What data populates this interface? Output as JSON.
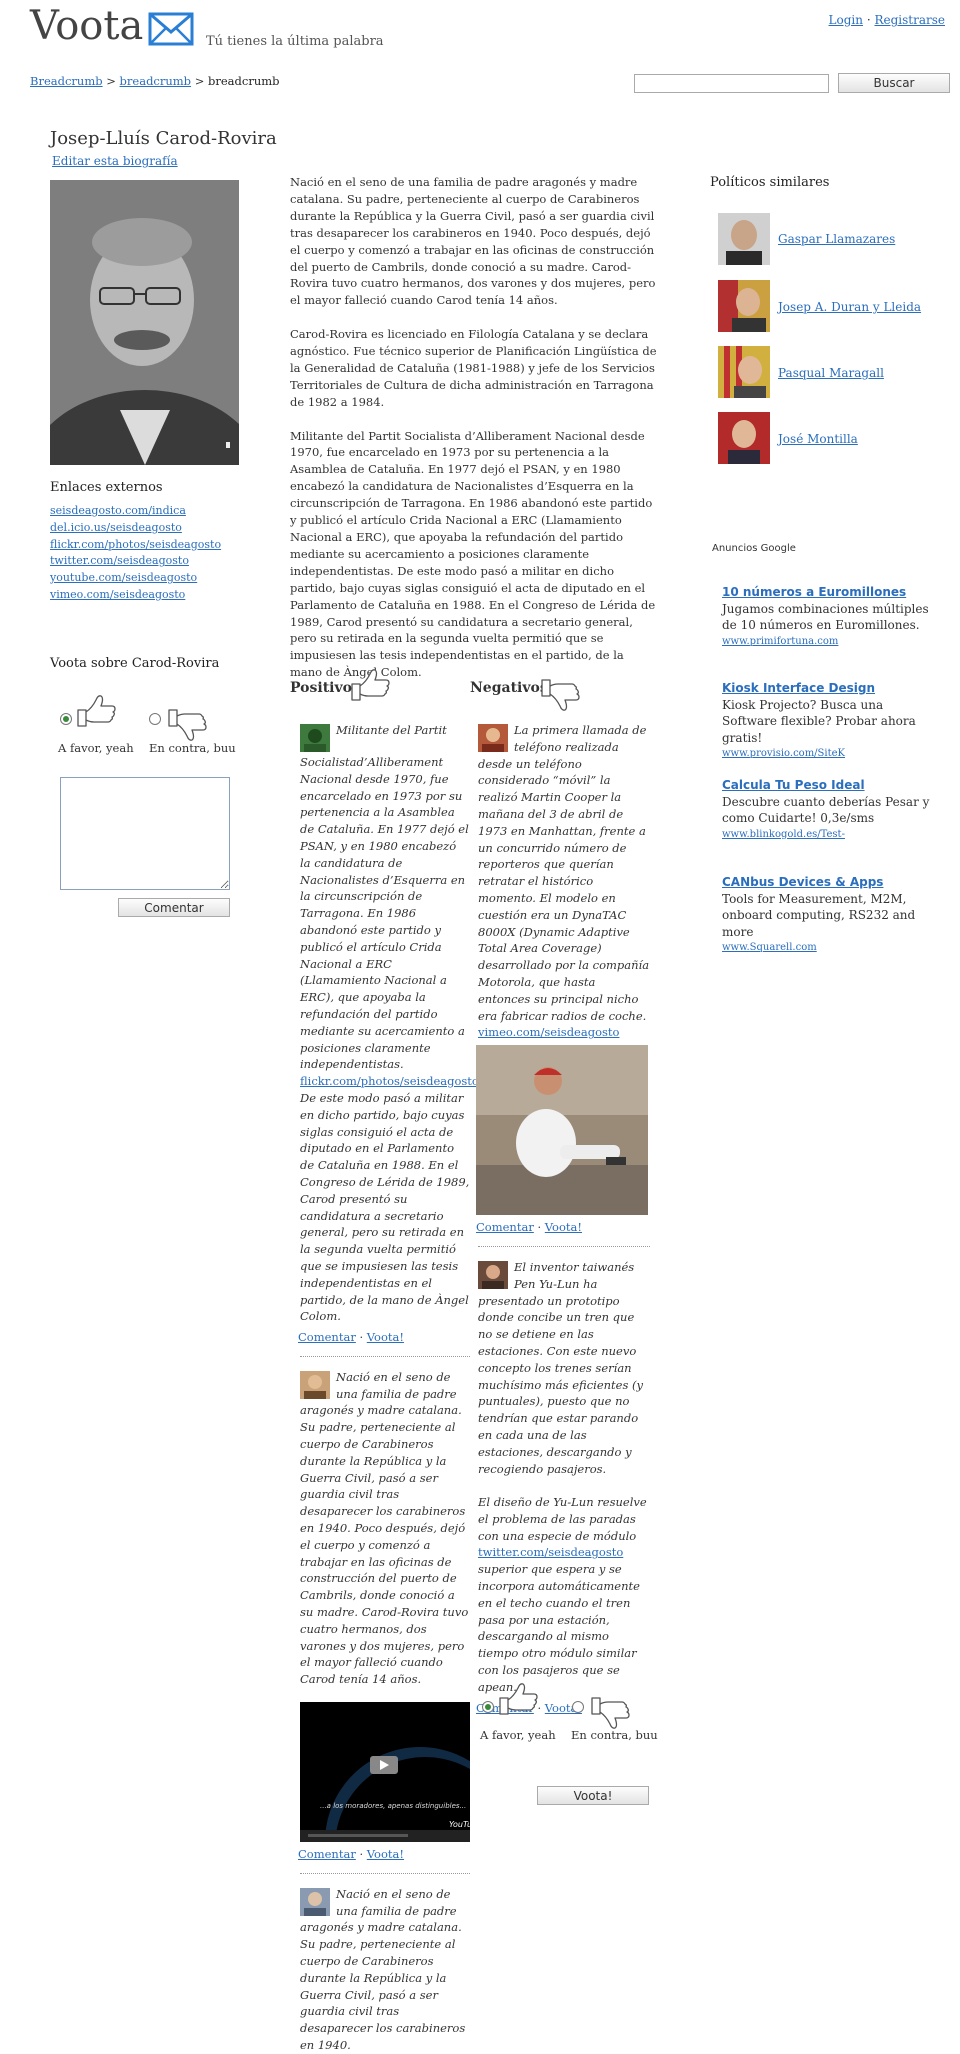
{
  "header": {
    "logo": "Voota",
    "tagline": "Tú tienes la última palabra",
    "login": "Login",
    "auth_separator": "·",
    "register": "Registrarse",
    "breadcrumb": [
      {
        "label": "Breadcrumb",
        "link": true
      },
      {
        "label": "breadcrumb",
        "link": true
      },
      {
        "label": "breadcrumb",
        "link": false
      }
    ],
    "breadcrumb_separator": ">",
    "search_button": "Buscar",
    "search_value": ""
  },
  "profile": {
    "name": "Josep-Lluís Carod-Rovira",
    "edit_bio": "Editar esta biografía",
    "external_links_title": "Enlaces externos",
    "external_links": [
      "seisdeagosto.com/indica",
      "del.icio.us/seisdeagosto",
      "flickr.com/photos/seisdeagosto",
      "twitter.com/seisdeagosto",
      "youtube.com/seisdeagosto",
      "vimeo.com/seisdeagosto"
    ]
  },
  "vote_box": {
    "title": "Voota sobre Carod-Rovira",
    "favor_label": "A favor, yeah",
    "contra_label": "En contra, buu",
    "favor_selected": true,
    "comment_value": "",
    "comment_button": "Comentar"
  },
  "bio": [
    "Nació en el seno de una familia de padre aragonés y madre catalana. Su padre, perteneciente al cuerpo de Carabineros durante la República y la Guerra Civil, pasó a ser guardia civil tras desaparecer los carabineros en 1940. Poco después, dejó el cuerpo y comenzó a trabajar en las oficinas de construcción del puerto de Cambrils, donde conoció a su madre. Carod-Rovira tuvo cuatro hermanos, dos varones y dos mujeres, pero el mayor falleció cuando Carod tenía 14 años.",
    "Carod-Rovira es licenciado en Filología Catalana y se declara agnóstico. Fue técnico superior de Planificación Lingüística de la Generalidad de Cataluña (1981-1988) y jefe de los Servicios Territoriales de Cultura de dicha administración en Tarragona de 1982 a 1984.",
    "Militante del Partit Socialista d’Alliberament Nacional desde 1970, fue encarcelado en 1973 por su pertenencia a la Asamblea de Cataluña. En 1977 dejó el PSAN, y en 1980 encabezó la candidatura de Nacionalistes d’Esquerra en la circunscripción de Tarragona. En 1986 abandonó este partido y publicó el artículo Crida Nacional a ERC (Llamamiento Nacional a ERC), que apoyaba la refundación del partido mediante su acercamiento a posiciones claramente independentistas. De este modo pasó a militar en dicho partido, bajo cuyas siglas consiguió el acta de diputado en el Parlamento de Cataluña en 1988. En el Congreso de Lérida de 1989, Carod presentó su candidatura a secretario general, pero su retirada en la segunda vuelta permitió que se impusiesen las tesis independentistas en el partido, de la mano de Àngel Colom."
  ],
  "positives": {
    "title": "Positivos",
    "comment_label": "Comentar",
    "voota_label": "Voota!",
    "meta_separator": "·",
    "items": [
      {
        "text1": "Militante del Partit Socialistad’Alliberament Nacional desde 1970, fue encarcelado en 1973 por su pertenencia a la Asamblea de Cataluña. En 1977 dejó el PSAN, y en 1980 encabezó la candidatura de Nacionalistes d’Esquerra en la circunscripción de Tarragona. En 1986 abandonó este partido y publicó el artículo Crida Nacional a ERC (Llamamiento Nacional a ERC), que apoyaba la refundación del partido mediante su acercamiento a posiciones claramente independentistas.",
        "link": "flickr.com/photos/seisdeagosto",
        "text2": "De este modo pasó a militar en dicho partido, bajo cuyas siglas consiguió el acta de diputado en el Parlamento de Cataluña en 1988. En el Congreso de Lérida de 1989, Carod presentó su candidatura a secretario general, pero su retirada en la segunda vuelta permitió que se impusiesen las tesis independentistas en el partido, de la mano de Àngel Colom."
      },
      {
        "text1": "Nació en el seno de una familia de padre aragonés y madre catalana. Su padre, perteneciente al cuerpo de Carabineros durante la República y la Guerra Civil, pasó a ser guardia civil tras desaparecer los carabineros en 1940. Poco después, dejó el cuerpo y comenzó a trabajar en las oficinas de construcción del puerto de Cambrils, donde conoció a su madre. Carod-Rovira tuvo cuatro hermanos, dos varones y dos mujeres, pero el mayor falleció cuando Carod tenía 14 años.",
        "video_caption": "...a los moradores, apenas distinguibles..."
      },
      {
        "text1": "Nació en el seno de una familia de padre aragonés y madre catalana. Su padre, perteneciente al cuerpo de Carabineros durante la República y la Guerra Civil, pasó a ser guardia civil tras desaparecer los carabineros en 1940."
      }
    ]
  },
  "negatives": {
    "title": "Negativos",
    "items": [
      {
        "text1": "La primera llamada de teléfono realizada desde un teléfono considerado “móvil” la realizó Martin Cooper la mañana del 3 de abril de 1973 en Manhattan, frente a un concurrido número de reporteros que querían retratar el histórico momento. El modelo en cuestión era un DynaTAC 8000X (Dynamic Adaptive Total Area Coverage) desarrollado por la compañía Motorola, que hasta entonces su principal nicho era fabricar radios de coche.",
        "link": "vimeo.com/seisdeagosto"
      },
      {
        "text1": "El inventor taiwanés Pen Yu-Lun ha presentado un prototipo donde concibe un tren que no se detiene en las estaciones. Con este nuevo concepto los trenes serían muchísimo más eficientes (y puntuales), puesto que no tendrían que estar parando en cada una de las estaciones, descargando y recogiendo pasajeros.",
        "text2": "El diseño de Yu-Lun resuelve el problema de las paradas con una especie de módulo",
        "link": "twitter.com/seisdeagosto",
        "text3": "superior que espera y se incorpora automáticamente en el techo cuando el tren pasa por una estación, descargando al mismo tiempo otro módulo similar con los pasajeros que se apean."
      }
    ],
    "vote_favor": "A favor, yeah",
    "vote_contra": "En contra, buu",
    "vote_button": "Voota!"
  },
  "similar": {
    "title": "Políticos similares",
    "items": [
      "Gaspar Llamazares",
      "Josep A. Duran y Lleida",
      "Pasqual Maragall",
      "José Montilla"
    ]
  },
  "ads": {
    "label": "Anuncios Google",
    "items": [
      {
        "title": "10 números a Euromillones",
        "text": "Jugamos combinaciones múltiples de 10 números en Euromillones.",
        "url": "www.primifortuna.com"
      },
      {
        "title": "Kiosk Interface Design",
        "text": "Kiosk Projecto? Busca una Software flexible? Probar ahora gratis!",
        "url": "www.provisio.com/SiteK"
      },
      {
        "title": "Calcula Tu Peso Ideal",
        "text": "Descubre cuanto deberías Pesar y como Cuidarte! 0,3e/sms",
        "url": "www.blinkogold.es/Test-"
      },
      {
        "title": "CANbus Devices & Apps",
        "text": "Tools for Measurement, M2M, onboard computing, RS232 and more",
        "url": "www.Squarell.com"
      }
    ]
  },
  "colors": {
    "link": "#2a6ebd",
    "logo_icon": "#2a7fd4",
    "radio_on": "#3a8a3a"
  }
}
